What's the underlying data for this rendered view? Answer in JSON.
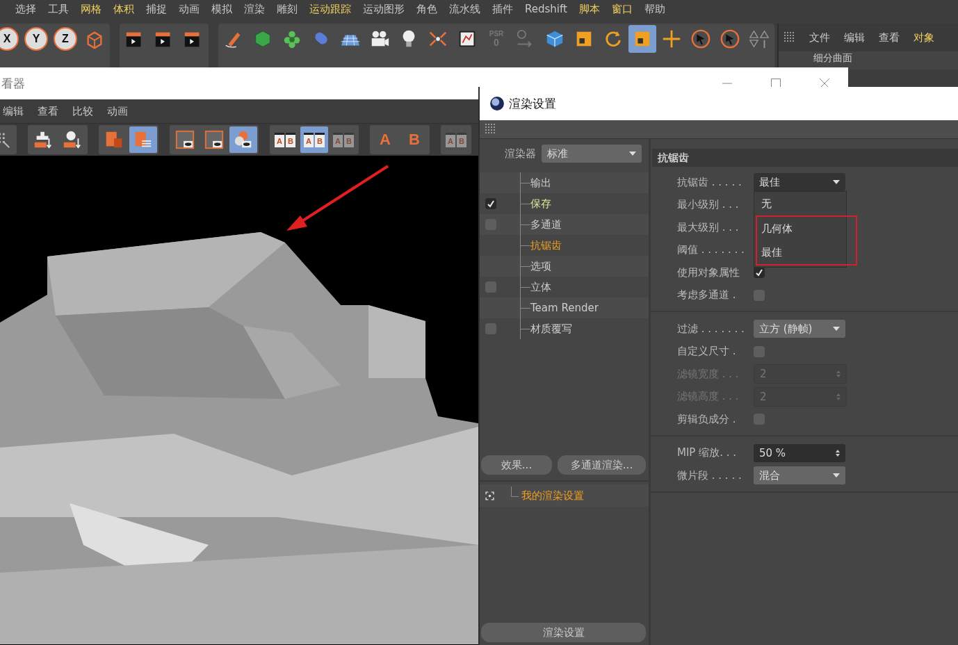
{
  "menu_bar": [
    {
      "label": "选择",
      "highlighted": false
    },
    {
      "label": "工具",
      "highlighted": false
    },
    {
      "label": "网格",
      "highlighted": true
    },
    {
      "label": "体积",
      "highlighted": true
    },
    {
      "label": "捕捉",
      "highlighted": false
    },
    {
      "label": "动画",
      "highlighted": false
    },
    {
      "label": "模拟",
      "highlighted": false
    },
    {
      "label": "渲染",
      "highlighted": false
    },
    {
      "label": "雕刻",
      "highlighted": false
    },
    {
      "label": "运动跟踪",
      "highlighted": true
    },
    {
      "label": "运动图形",
      "highlighted": false
    },
    {
      "label": "角色",
      "highlighted": false
    },
    {
      "label": "流水线",
      "highlighted": false
    },
    {
      "label": "插件",
      "highlighted": false
    },
    {
      "label": "Redshift",
      "highlighted": false
    },
    {
      "label": "脚本",
      "highlighted": true
    },
    {
      "label": "窗口",
      "highlighted": true
    },
    {
      "label": "帮助",
      "highlighted": false
    }
  ],
  "main_toolbar": [
    [
      {
        "kind": "axis",
        "label": "X",
        "on": false
      },
      {
        "kind": "axis",
        "label": "Y",
        "on": false
      },
      {
        "kind": "axis",
        "label": "Z",
        "on": false
      },
      {
        "kind": "box",
        "on": false
      }
    ],
    [
      {
        "kind": "clapper",
        "on": false
      },
      {
        "kind": "clapper",
        "on": false
      },
      {
        "kind": "clapper",
        "on": false
      }
    ],
    [
      {
        "kind": "pen",
        "on": false
      },
      {
        "kind": "object",
        "on": false
      },
      {
        "kind": "flower",
        "on": false
      },
      {
        "kind": "capsule",
        "on": false
      },
      {
        "kind": "floor",
        "on": false
      },
      {
        "kind": "camera",
        "on": false
      },
      {
        "kind": "bulb",
        "on": false
      },
      {
        "kind": "burst",
        "on": false
      },
      {
        "kind": "frame",
        "on": false
      },
      {
        "kind": "psr",
        "label": "PSR",
        "sub": "0",
        "on": false
      },
      {
        "kind": "lock",
        "on": false
      },
      {
        "kind": "cube",
        "on": false
      },
      {
        "kind": "scale",
        "on": false
      },
      {
        "kind": "rotate",
        "on": false
      },
      {
        "kind": "scale",
        "on": true
      },
      {
        "kind": "move",
        "on": false
      },
      {
        "kind": "select",
        "on": false
      },
      {
        "kind": "select",
        "on": false
      },
      {
        "kind": "mirror",
        "on": false
      }
    ]
  ],
  "object_panel": {
    "menu": [
      {
        "label": "文件",
        "highlighted": false
      },
      {
        "label": "编辑",
        "highlighted": false
      },
      {
        "label": "查看",
        "highlighted": false
      },
      {
        "label": "对象",
        "highlighted": true
      }
    ],
    "object_row": "细分曲面"
  },
  "viewer": {
    "title": "看器",
    "menu": [
      "编辑",
      "查看",
      "比较",
      "动画"
    ],
    "toolbar": [
      [
        {
          "kind": "grid",
          "on": false,
          "disabled": false
        }
      ],
      [
        {
          "kind": "plusdown",
          "on": false,
          "disabled": false
        },
        {
          "kind": "circledown",
          "on": false,
          "disabled": false
        }
      ],
      [
        {
          "kind": "trashdoc",
          "on": false,
          "disabled": false
        },
        {
          "kind": "doclist",
          "on": true,
          "disabled": false
        }
      ],
      [
        {
          "kind": "frameeye",
          "on": false,
          "disabled": false
        },
        {
          "kind": "frameeye",
          "on": false,
          "disabled": false
        },
        {
          "kind": "circleseye",
          "on": true,
          "disabled": false
        }
      ],
      [
        {
          "kind": "ab",
          "letters": [
            "A",
            "B"
          ],
          "on": false,
          "disabled": false
        },
        {
          "kind": "ab",
          "letters": [
            "A",
            "B"
          ],
          "on": true,
          "disabled": false
        },
        {
          "kind": "ab",
          "letters": [
            "A",
            "B"
          ],
          "on": false,
          "disabled": true
        }
      ],
      [
        {
          "kind": "arrowletter",
          "letters": [
            "A"
          ],
          "on": false,
          "disabled": false
        },
        {
          "kind": "arrowletter",
          "letters": [
            "B"
          ],
          "on": false,
          "disabled": false
        }
      ],
      [
        {
          "kind": "ab",
          "letters": [
            "A",
            "B"
          ],
          "on": false,
          "disabled": true
        }
      ]
    ]
  },
  "render_settings": {
    "title": "渲染设置",
    "renderer_label": "渲染器",
    "renderer_value": "标准",
    "tree": [
      {
        "label": "输出",
        "kind": "plain",
        "selected": false,
        "highlighted": false
      },
      {
        "label": "保存",
        "kind": "toggle",
        "checked": true,
        "selected": false,
        "highlighted": true
      },
      {
        "label": "多通道",
        "kind": "toggle",
        "checked": false,
        "selected": false,
        "highlighted": false
      },
      {
        "label": "抗锯齿",
        "kind": "plain",
        "selected": true,
        "highlighted": false
      },
      {
        "label": "选项",
        "kind": "plain",
        "selected": false,
        "highlighted": false
      },
      {
        "label": "立体",
        "kind": "toggle",
        "checked": false,
        "selected": false,
        "highlighted": false
      },
      {
        "label": "Team Render",
        "kind": "plain",
        "selected": false,
        "highlighted": false
      },
      {
        "label": "材质覆写",
        "kind": "toggle",
        "checked": false,
        "selected": false,
        "highlighted": false
      }
    ],
    "buttons": [
      "效果...",
      "多通道渲染..."
    ],
    "presets": [
      {
        "label": "我的渲染设置",
        "selected": true
      }
    ],
    "bottom_button": "渲染设置",
    "section_title": "抗锯齿",
    "groups": [
      [
        {
          "kind": "dropdown",
          "label": "抗锯齿 . . . . .",
          "value": "最佳",
          "open": true,
          "options": [
            {
              "label": "无",
              "boxed": false
            },
            {
              "label": "几何体",
              "boxed": true
            },
            {
              "label": "最佳",
              "boxed": true
            }
          ]
        },
        {
          "kind": "label",
          "label": "最小级别 . . ."
        },
        {
          "kind": "label",
          "label": "最大级别 . . ."
        },
        {
          "kind": "label",
          "label": "阈值 . . . . . . ."
        },
        {
          "kind": "checkbox",
          "label": "使用对象属性",
          "checked": true
        },
        {
          "kind": "checkbox",
          "label": "考虑多通道 .",
          "checked": false
        }
      ],
      [
        {
          "kind": "dropdown",
          "label": "过滤 . . . . . . .",
          "value": "立方 (静帧)",
          "open": false
        },
        {
          "kind": "checkbox",
          "label": "自定义尺寸 .",
          "checked": false
        },
        {
          "kind": "number",
          "label": "滤镜宽度 . . .",
          "value": "2",
          "disabled": true
        },
        {
          "kind": "number",
          "label": "滤镜高度 . . .",
          "value": "2",
          "disabled": true
        },
        {
          "kind": "checkbox",
          "label": "剪辑负成分 .",
          "checked": false
        }
      ],
      [
        {
          "kind": "number",
          "label": "MIP 缩放. . .",
          "value": "50 %",
          "disabled": false
        },
        {
          "kind": "dropdown",
          "label": "微片段 . . . . .",
          "value": "混合",
          "open": false
        }
      ]
    ]
  }
}
